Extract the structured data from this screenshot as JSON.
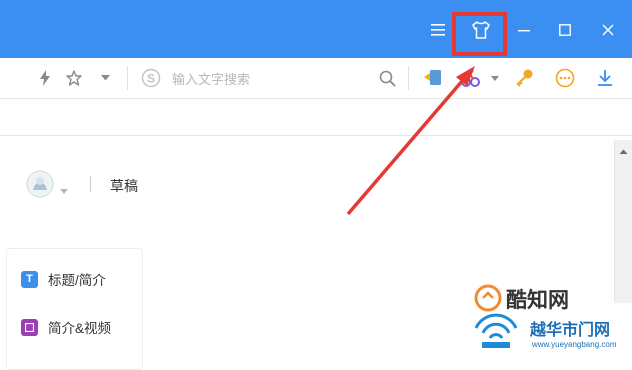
{
  "window": {
    "controls": {
      "menu_icon": "hamburger-icon",
      "skin_icon": "tshirt-icon",
      "minimize_icon": "minimize-icon",
      "maximize_icon": "maximize-icon",
      "close_icon": "close-icon"
    },
    "accent_color": "#3b8ff0",
    "highlight_color": "#e53935"
  },
  "toolbar": {
    "search_placeholder": "输入文字搜索",
    "search_engine_glyph": "S"
  },
  "page": {
    "draft_label": "草稿"
  },
  "menu": {
    "items": [
      {
        "badge": "T",
        "label": "标题/简介",
        "color": "#3d8fe8"
      },
      {
        "badge": "",
        "label": "简介&视频",
        "color": "#9c3fb3"
      }
    ]
  },
  "watermarks": {
    "brand": "酷知网",
    "site_name": "越华市门网",
    "site_url": "www.yueyangbang.com"
  }
}
